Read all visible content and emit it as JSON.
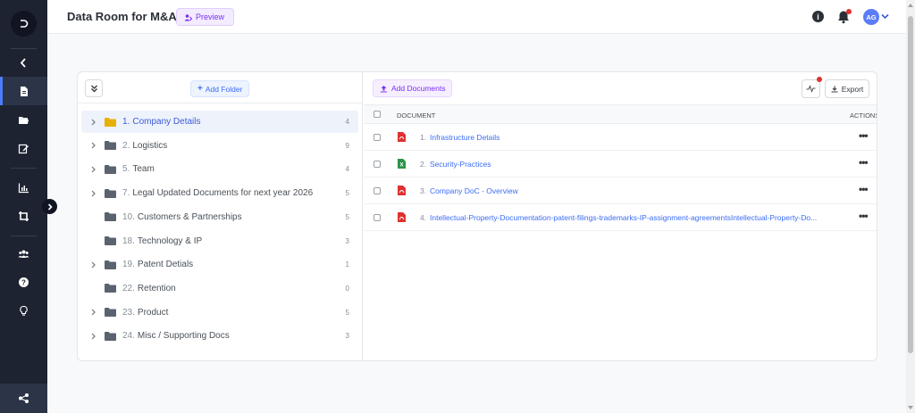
{
  "header": {
    "title": "Data Room for M&A",
    "preview_label": "Preview",
    "avatar_initials": "AG"
  },
  "colors": {
    "sidebar": "#1d2331",
    "accent_blue": "#3b6cf6",
    "accent_purple": "#7b2ff7",
    "folder_active": "#e8b100",
    "folder_default": "#5b6270",
    "pdf_red": "#e03131",
    "xls_green": "#2b9348"
  },
  "sidebar": {
    "icons": [
      "logo-icon",
      "back-chevron-icon",
      "document-icon",
      "folder-open-icon",
      "edit-icon",
      "chart-icon",
      "crop-icon",
      "team-icon",
      "help-icon",
      "lightbulb-icon",
      "share-icon"
    ]
  },
  "folders_panel": {
    "add_folder_label": "Add Folder",
    "folders": [
      {
        "num": "1.",
        "name": "Company Details",
        "count": "4",
        "expandable": true,
        "active": true
      },
      {
        "num": "2.",
        "name": "Logistics",
        "count": "9",
        "expandable": true,
        "active": false
      },
      {
        "num": "5.",
        "name": "Team",
        "count": "4",
        "expandable": true,
        "active": false
      },
      {
        "num": "7.",
        "name": "Legal Updated Documents for next year 2026",
        "count": "5",
        "expandable": true,
        "active": false
      },
      {
        "num": "10.",
        "name": "Customers & Partnerships",
        "count": "5",
        "expandable": false,
        "active": false
      },
      {
        "num": "18.",
        "name": "Technology & IP",
        "count": "3",
        "expandable": false,
        "active": false
      },
      {
        "num": "19.",
        "name": "Patent Detials",
        "count": "1",
        "expandable": true,
        "active": false
      },
      {
        "num": "22.",
        "name": "Retention",
        "count": "0",
        "expandable": false,
        "active": false
      },
      {
        "num": "23.",
        "name": "Product",
        "count": "5",
        "expandable": true,
        "active": false
      },
      {
        "num": "24.",
        "name": "Misc / Supporting Docs",
        "count": "3",
        "expandable": true,
        "active": false
      }
    ]
  },
  "documents_panel": {
    "add_documents_label": "Add Documents",
    "export_label": "Export",
    "columns": {
      "document": "DOCUMENT",
      "actions": "ACTIONS"
    },
    "documents": [
      {
        "num": "1.",
        "name": "Infrastructure Details",
        "type": "pdf"
      },
      {
        "num": "2.",
        "name": "Security-Practices",
        "type": "xls"
      },
      {
        "num": "3.",
        "name": "Company DoC - Overview",
        "type": "pdf"
      },
      {
        "num": "4.",
        "name": "Intellectual-Property-Documentation-patent-filings-trademarks-IP-assignment-agreementsIntellectual-Property-Do...",
        "type": "pdf"
      }
    ]
  }
}
